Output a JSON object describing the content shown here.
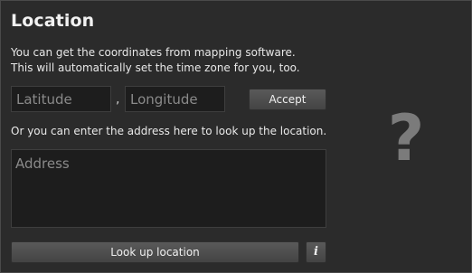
{
  "panel": {
    "title": "Location",
    "description_line1": "You can get the coordinates from mapping software.",
    "description_line2": "This will automatically set the time zone for you, too."
  },
  "coordinates": {
    "latitude_placeholder": "Latitude",
    "latitude_value": "",
    "separator": ",",
    "longitude_placeholder": "Longitude",
    "longitude_value": "",
    "accept_label": "Accept"
  },
  "address": {
    "instruction": "Or you can enter the address here to look up the location.",
    "placeholder": "Address",
    "value": "",
    "lookup_label": "Look up location",
    "info_label": "i"
  },
  "status": {
    "icon": "question-mark-icon",
    "glyph": "?"
  },
  "colors": {
    "background": "#2b2b2b",
    "field_background": "#1d1d1d",
    "button_gradient_top": "#5a5a5a",
    "button_gradient_bottom": "#444444",
    "muted_icon": "#7b7b7b"
  }
}
